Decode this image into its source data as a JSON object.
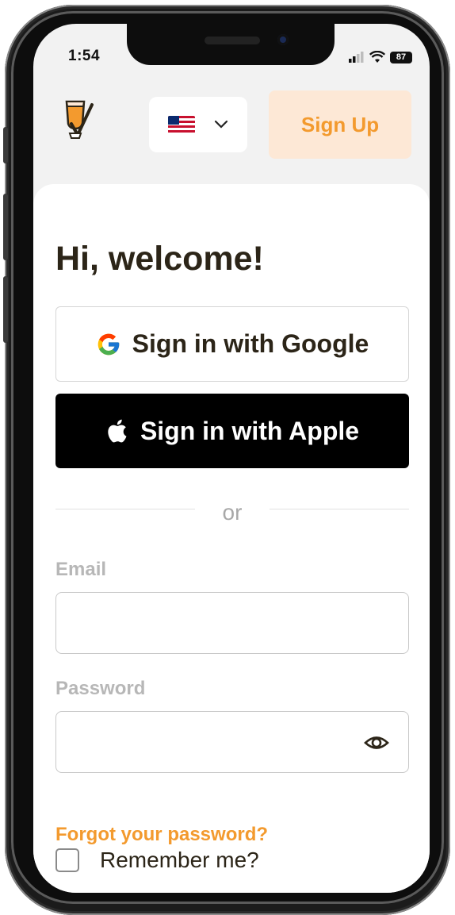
{
  "status_bar": {
    "time": "1:54",
    "battery": "87"
  },
  "header": {
    "language_flag": "us-flag-icon",
    "signup_label": "Sign Up"
  },
  "login": {
    "title": "Hi, welcome!",
    "google_label": "Sign in with Google",
    "apple_label": "Sign in with Apple",
    "divider_text": "or",
    "email_label": "Email",
    "email_value": "",
    "password_label": "Password",
    "password_value": "",
    "forgot_label": "Forgot your password?",
    "remember_label": "Remember me?"
  },
  "colors": {
    "accent": "#f39a2e",
    "accent_bg": "#fde8d6",
    "text": "#2c2518"
  }
}
